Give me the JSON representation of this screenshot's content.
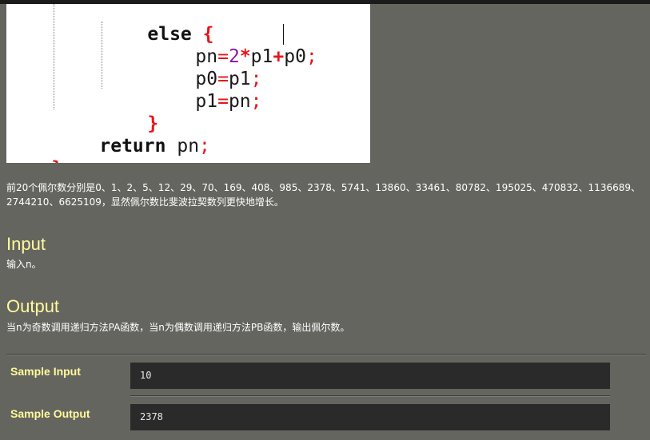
{
  "code": {
    "else_kw": "else",
    "brace_open": "{",
    "pn_var": "pn",
    "eq": "=",
    "two": "2",
    "star": "*",
    "p1_var": "p1",
    "plus": "+",
    "p0_var": "p0",
    "semi": ";",
    "return_kw": "return",
    "brace_close": "}"
  },
  "description": "前20个佩尔数分别是0、1、2、5、12、29、70、169、408、985、2378、5741、13860、33461、80782、195025、470832、1136689、2744210、6625109，显然佩尔数比斐波拉契数列更快地增长。",
  "input_section": {
    "title": "Input",
    "text": "输入n。"
  },
  "output_section": {
    "title": "Output",
    "text": "当n为奇数调用递归方法PA函数，当n为偶数调用递归方法PB函数，输出佩尔数。"
  },
  "sample_input": {
    "label": "Sample Input",
    "value": "10"
  },
  "sample_output": {
    "label": "Sample Output",
    "value": "2378"
  }
}
